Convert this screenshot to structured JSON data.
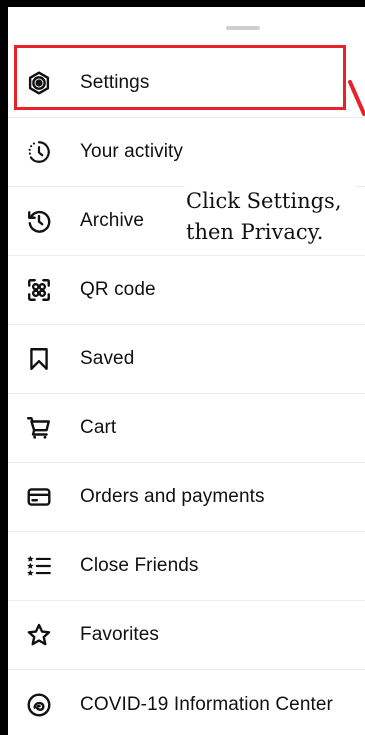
{
  "menu": {
    "items": [
      {
        "id": "settings",
        "label": "Settings",
        "icon": "settings-gear-icon"
      },
      {
        "id": "your-activity",
        "label": "Your activity",
        "icon": "activity-clock-icon"
      },
      {
        "id": "archive",
        "label": "Archive",
        "icon": "archive-history-icon"
      },
      {
        "id": "qr-code",
        "label": "QR code",
        "icon": "qr-code-icon"
      },
      {
        "id": "saved",
        "label": "Saved",
        "icon": "bookmark-icon"
      },
      {
        "id": "cart",
        "label": "Cart",
        "icon": "cart-icon"
      },
      {
        "id": "orders-payments",
        "label": "Orders and payments",
        "icon": "card-icon"
      },
      {
        "id": "close-friends",
        "label": "Close Friends",
        "icon": "close-friends-list-icon"
      },
      {
        "id": "favorites",
        "label": "Favorites",
        "icon": "star-icon"
      },
      {
        "id": "covid-info",
        "label": "COVID-19 Information Center",
        "icon": "covid-info-icon"
      }
    ]
  },
  "annotation": {
    "text": "Click Settings, then Privacy."
  },
  "colors": {
    "highlight": "#e6222a",
    "text": "#111111",
    "divider": "#ececec"
  }
}
